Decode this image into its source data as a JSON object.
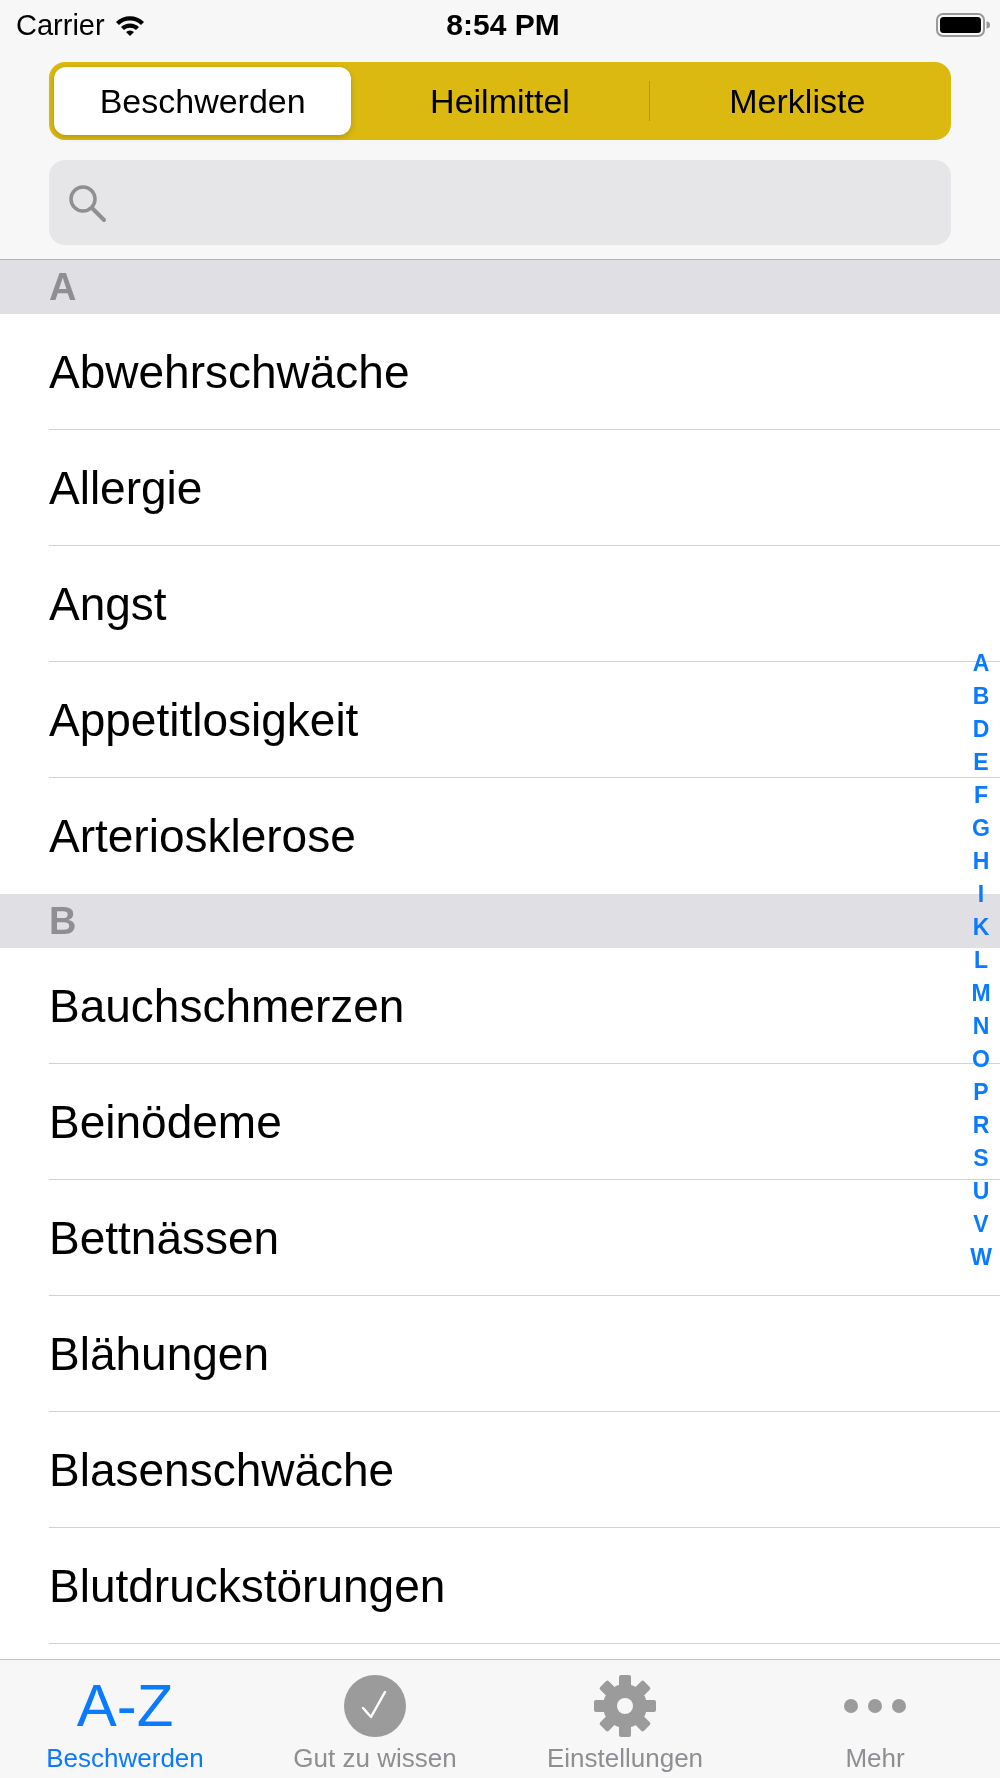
{
  "status_bar": {
    "carrier": "Carrier",
    "time": "8:54 PM"
  },
  "segments": [
    {
      "label": "Beschwerden",
      "selected": true
    },
    {
      "label": "Heilmittel",
      "selected": false
    },
    {
      "label": "Merkliste",
      "selected": false
    }
  ],
  "sections": [
    {
      "letter": "A",
      "rows": [
        "Abwehrschwäche",
        "Allergie",
        "Angst",
        "Appetitlosigkeit",
        "Arteriosklerose"
      ]
    },
    {
      "letter": "B",
      "rows": [
        "Bauchschmerzen",
        "Beinödeme",
        "Bettnässen",
        "Blähungen",
        "Blasenschwäche",
        "Blutdruckstörungen"
      ]
    }
  ],
  "index": [
    "A",
    "B",
    "D",
    "E",
    "F",
    "G",
    "H",
    "I",
    "K",
    "L",
    "M",
    "N",
    "O",
    "P",
    "R",
    "S",
    "U",
    "V",
    "W"
  ],
  "tab_bar": [
    {
      "kind": "text",
      "icon_text": "A-Z",
      "label": "Beschwerden",
      "selected": true
    },
    {
      "kind": "check",
      "label": "Gut zu wissen",
      "selected": false
    },
    {
      "kind": "gear",
      "label": "Einstellungen",
      "selected": false
    },
    {
      "kind": "dots",
      "label": "Mehr",
      "selected": false
    }
  ]
}
